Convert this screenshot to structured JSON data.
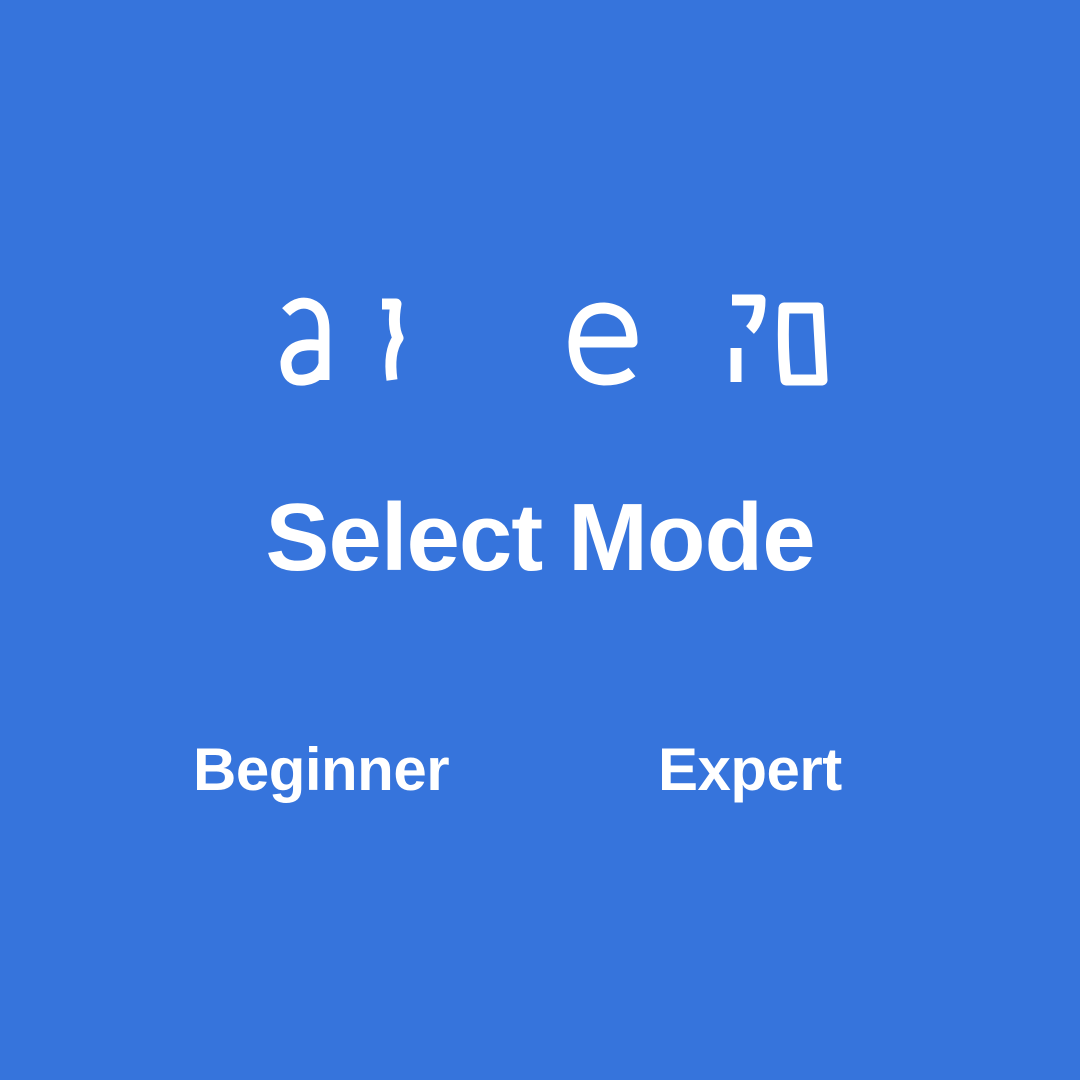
{
  "screen": {
    "background_color": "#3674DC",
    "text_color": "#FFFFFF"
  },
  "logo": {
    "name": "garbled-logo",
    "description_glyphs": "a  e n"
  },
  "title": "Select Mode",
  "modes": [
    {
      "label": "Beginner"
    },
    {
      "label": "Expert"
    }
  ]
}
